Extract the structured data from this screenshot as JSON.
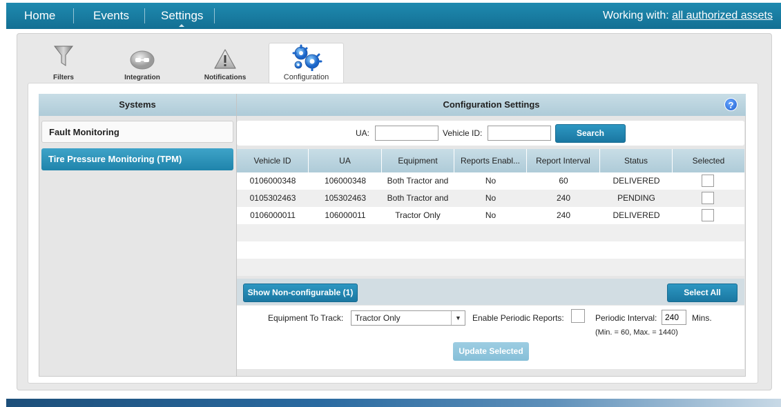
{
  "nav": {
    "items": [
      "Home",
      "Events",
      "Settings"
    ],
    "working_label": "Working with:",
    "working_link": "all authorized assets"
  },
  "tabs": [
    {
      "label": "Filters",
      "icon": "funnel-icon"
    },
    {
      "label": "Integration",
      "icon": "integration-icon"
    },
    {
      "label": "Notifications",
      "icon": "warning-icon"
    },
    {
      "label": "Configuration",
      "icon": "gears-icon"
    }
  ],
  "systems": {
    "header": "Systems",
    "items": [
      "Fault Monitoring",
      "Tire Pressure Monitoring (TPM)"
    ]
  },
  "config": {
    "header": "Configuration Settings",
    "help": "?",
    "ua_label": "UA:",
    "vehicle_id_label": "Vehicle ID:",
    "ua_value": "",
    "vehicle_id_value": "",
    "search_label": "Search"
  },
  "table": {
    "columns": [
      "Vehicle ID",
      "UA",
      "Equipment",
      "Reports Enabl...",
      "Report Interval",
      "Status",
      "Selected"
    ],
    "rows": [
      {
        "vehicle_id": "0106000348",
        "ua": "106000348",
        "equipment": "Both Tractor and",
        "reports": "No",
        "interval": "60",
        "status": "DELIVERED"
      },
      {
        "vehicle_id": "0105302463",
        "ua": "105302463",
        "equipment": "Both Tractor and",
        "reports": "No",
        "interval": "240",
        "status": "PENDING"
      },
      {
        "vehicle_id": "0106000011",
        "ua": "106000011",
        "equipment": "Tractor Only",
        "reports": "No",
        "interval": "240",
        "status": "DELIVERED"
      }
    ]
  },
  "actions": {
    "show_nonconfig": "Show Non-configurable (1)",
    "select_all": "Select All",
    "equipment_label": "Equipment To Track:",
    "equipment_value": "Tractor Only",
    "enable_periodic_label": "Enable Periodic Reports:",
    "periodic_interval_label": "Periodic Interval:",
    "periodic_interval_value": "240",
    "mins_label": "Mins.",
    "range_note": "(Min. = 60, Max. = 1440)",
    "update_label": "Update Selected"
  },
  "colors": {
    "nav_bar": "#1a80a6",
    "accent_button": "#2189b3",
    "header_band": "#bdd5df",
    "active_system": "#2d94bb"
  }
}
